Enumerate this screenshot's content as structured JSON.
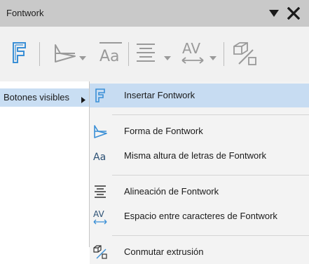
{
  "window": {
    "title": "Fontwork"
  },
  "toolbar": {
    "items": [
      {
        "icon": "fontwork-insert-icon"
      },
      {
        "icon": "fontwork-shape-icon",
        "has_dropdown": true
      },
      {
        "icon": "fontwork-same-height-icon"
      },
      {
        "icon": "fontwork-alignment-icon",
        "has_dropdown": true
      },
      {
        "icon": "fontwork-character-spacing-icon",
        "has_dropdown": true
      },
      {
        "icon": "toggle-extrusion-icon"
      }
    ]
  },
  "left_panel": {
    "visible_buttons_label": "Botones visibles"
  },
  "submenu": {
    "items": [
      {
        "label": "Insertar Fontwork",
        "icon": "fontwork-insert-icon",
        "highlighted": true
      },
      {
        "label": "Forma de Fontwork",
        "icon": "fontwork-shape-icon"
      },
      {
        "label": "Misma altura de letras de Fontwork",
        "icon": "fontwork-same-height-icon"
      },
      {
        "label": "Alineación de Fontwork",
        "icon": "fontwork-alignment-icon"
      },
      {
        "label": "Espacio entre caracteres de Fontwork",
        "icon": "fontwork-character-spacing-icon"
      },
      {
        "label": "Conmutar extrusión",
        "icon": "toggle-extrusion-icon"
      }
    ]
  },
  "colors": {
    "titlebar": "#c9c9c9",
    "toolbar": "#f1f1f1",
    "highlight": "#c7dcf2",
    "icon_blue": "#3a8fd6"
  }
}
